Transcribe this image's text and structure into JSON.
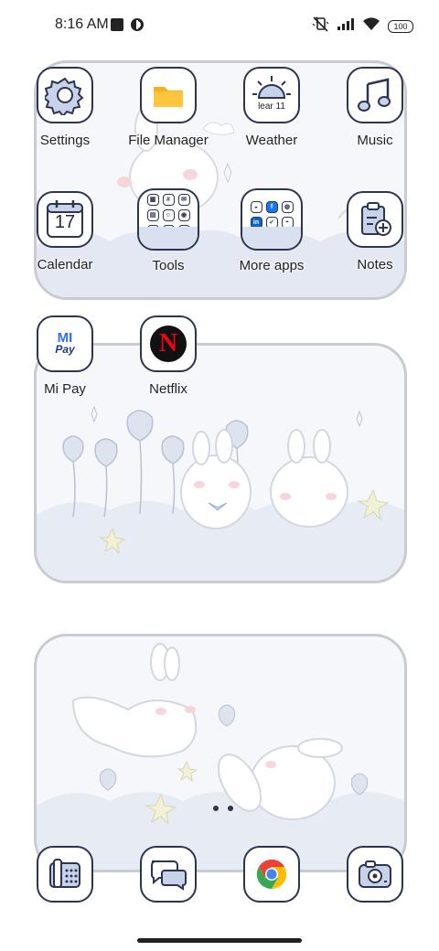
{
  "status_bar": {
    "time": "8:16 AM",
    "left_icons": [
      "square-notification-icon",
      "app-notification-icon"
    ],
    "right_icons": [
      "vibrate-off-icon",
      "signal-icon",
      "wifi-icon",
      "battery-icon"
    ],
    "battery_level": "100"
  },
  "widget1": {
    "apps": [
      {
        "label": "Settings",
        "icon": "gear-icon"
      },
      {
        "label": "File Manager",
        "icon": "folder-icon"
      },
      {
        "label": "Weather",
        "icon": "sun-icon",
        "icon_text": "lear 11"
      },
      {
        "label": "Music",
        "icon": "music-note-icon"
      },
      {
        "label": "Calendar",
        "icon": "calendar-icon",
        "icon_text": "17"
      },
      {
        "label": "Tools",
        "icon": "folder-grid-icon"
      },
      {
        "label": "More apps",
        "icon": "folder-grid-icon"
      },
      {
        "label": "Notes",
        "icon": "clipboard-plus-icon"
      }
    ]
  },
  "widget2": {
    "apps": [
      {
        "label": "Mi Pay",
        "icon": "mi-pay-icon",
        "icon_text_top": "MI",
        "icon_text_bottom": "Pay"
      },
      {
        "label": "Netflix",
        "icon": "netflix-icon",
        "icon_text": "N"
      }
    ]
  },
  "dock": {
    "apps": [
      {
        "icon": "phone-icon"
      },
      {
        "icon": "messages-icon"
      },
      {
        "icon": "chrome-icon"
      },
      {
        "icon": "camera-icon"
      }
    ]
  },
  "colors": {
    "icon_border": "#2c3550",
    "widget_border": "#c9cbd3",
    "accent_blue": "#d9e1f0"
  }
}
